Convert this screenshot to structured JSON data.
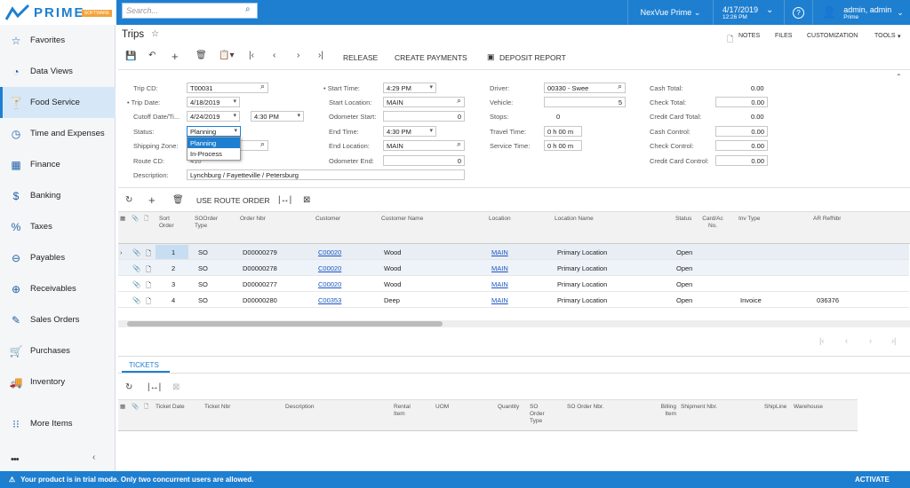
{
  "brand": {
    "word": "PRIME",
    "sub": "SOFTWARE"
  },
  "topbar": {
    "search_placeholder": "Search...",
    "company": "NexVue Prime",
    "date": "4/17/2019",
    "time": "12:26 PM",
    "user": "admin, admin",
    "user_sub": "Prime"
  },
  "sidebar": {
    "items": [
      "Favorites",
      "Data Views",
      "Food Service",
      "Time and Expenses",
      "Finance",
      "Banking",
      "Taxes",
      "Payables",
      "Receivables",
      "Sales Orders",
      "Purchases",
      "Inventory"
    ],
    "more": "More Items"
  },
  "page": {
    "title": "Trips",
    "actions": [
      "NOTES",
      "FILES",
      "CUSTOMIZATION",
      "TOOLS"
    ]
  },
  "toolbar": {
    "release": "RELEASE",
    "create_payments": "CREATE PAYMENTS",
    "deposit_report": "DEPOSIT REPORT"
  },
  "form": {
    "trip_cd": {
      "label": "Trip CD:",
      "value": "T00031"
    },
    "trip_date": {
      "label": "Trip Date:",
      "value": "4/18/2019"
    },
    "cutoff": {
      "label": "Cutoff Date/Ti...",
      "date": "4/24/2019",
      "time": "4:30 PM"
    },
    "status": {
      "label": "Status:",
      "value": "Planning",
      "options": [
        "Planning",
        "In-Process"
      ]
    },
    "shipping_zone": {
      "label": "Shipping Zone:"
    },
    "route_cd": {
      "label": "Route CD:",
      "value": "410"
    },
    "description": {
      "label": "Description:",
      "value": "Lynchburg / Fayetteville / Petersburg"
    },
    "start_time": {
      "label": "Start Time:",
      "value": "4:29 PM"
    },
    "start_location": {
      "label": "Start Location:",
      "value": "MAIN"
    },
    "odometer_start": {
      "label": "Odometer Start:",
      "value": "0"
    },
    "end_time": {
      "label": "End Time:",
      "value": "4:30 PM"
    },
    "end_location": {
      "label": "End Location:",
      "value": "MAIN"
    },
    "odometer_end": {
      "label": "Odometer End:",
      "value": "0"
    },
    "driver": {
      "label": "Driver:",
      "value": "00330 - Swee"
    },
    "vehicle": {
      "label": "Vehicle:",
      "value": "5"
    },
    "stops": {
      "label": "Stops:",
      "value": "0"
    },
    "travel_time": {
      "label": "Travel Time:",
      "value": "0 h 00 m"
    },
    "service_time": {
      "label": "Service Time:",
      "value": "0 h 00 m"
    },
    "cash_total": {
      "label": "Cash Total:",
      "value": "0.00"
    },
    "check_total": {
      "label": "Check Total:",
      "value": "0.00"
    },
    "cc_total": {
      "label": "Credit Card Total:",
      "value": "0.00"
    },
    "cash_control": {
      "label": "Cash Control:",
      "value": "0.00"
    },
    "check_control": {
      "label": "Check Control:",
      "value": "0.00"
    },
    "cc_control": {
      "label": "Credit Card Control:",
      "value": "0.00"
    }
  },
  "grid": {
    "use_route_order": "USE ROUTE ORDER",
    "headers": [
      "Sort Order",
      "SOOrder Type",
      "Order Nbr",
      "Customer",
      "Customer Name",
      "Location",
      "Location Name",
      "Status",
      "Card/Ac No.",
      "Inv Type",
      "AR RefNbr"
    ],
    "rows": [
      {
        "sort": "1",
        "type": "SO",
        "order": "D00000279",
        "customer": "C00020",
        "name": "Wood",
        "location": "MAIN",
        "loc_name": "Primary Location",
        "status": "Open",
        "card": "",
        "inv_type": "",
        "ar": ""
      },
      {
        "sort": "2",
        "type": "SO",
        "order": "D00000278",
        "customer": "C00020",
        "name": "Wood",
        "location": "MAIN",
        "loc_name": "Primary Location",
        "status": "Open",
        "card": "",
        "inv_type": "",
        "ar": ""
      },
      {
        "sort": "3",
        "type": "SO",
        "order": "D00000277",
        "customer": "C00020",
        "name": "Wood",
        "location": "MAIN",
        "loc_name": "Primary Location",
        "status": "Open",
        "card": "",
        "inv_type": "",
        "ar": ""
      },
      {
        "sort": "4",
        "type": "SO",
        "order": "D00000280",
        "customer": "C00353",
        "name": "Deep",
        "location": "MAIN",
        "loc_name": "Primary Location",
        "status": "Open",
        "card": "",
        "inv_type": "Invoice",
        "ar": "036376"
      }
    ]
  },
  "tickets": {
    "tab": "TICKETS",
    "headers": [
      "Ticket Date",
      "Ticket Nbr",
      "Description",
      "Rental Item",
      "UOM",
      "Quantity",
      "SO Order Type",
      "SO Order Nbr.",
      "Billing Item",
      "Shipment Nbr.",
      "ShipLine",
      "Warehouse"
    ]
  },
  "footer": {
    "message": "Your product is in trial mode. Only two concurrent users are allowed.",
    "activate": "ACTIVATE"
  }
}
